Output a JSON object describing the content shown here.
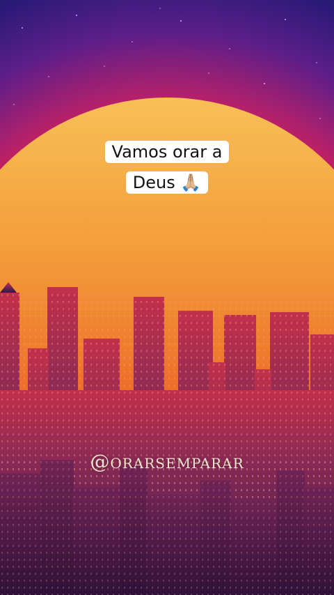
{
  "caption": {
    "line1": "Vamos orar a",
    "line2": "Deus 🙏🏼"
  },
  "watermark": {
    "handle": "@orarsemparar"
  },
  "colors": {
    "sky_top": "#3a1a8a",
    "sky_red": "#e0203a",
    "sun_top": "#f7b24a",
    "sun_bottom": "#e2441a",
    "city_dark": "#4a1a4e",
    "city_mid": "#9a2a48"
  }
}
